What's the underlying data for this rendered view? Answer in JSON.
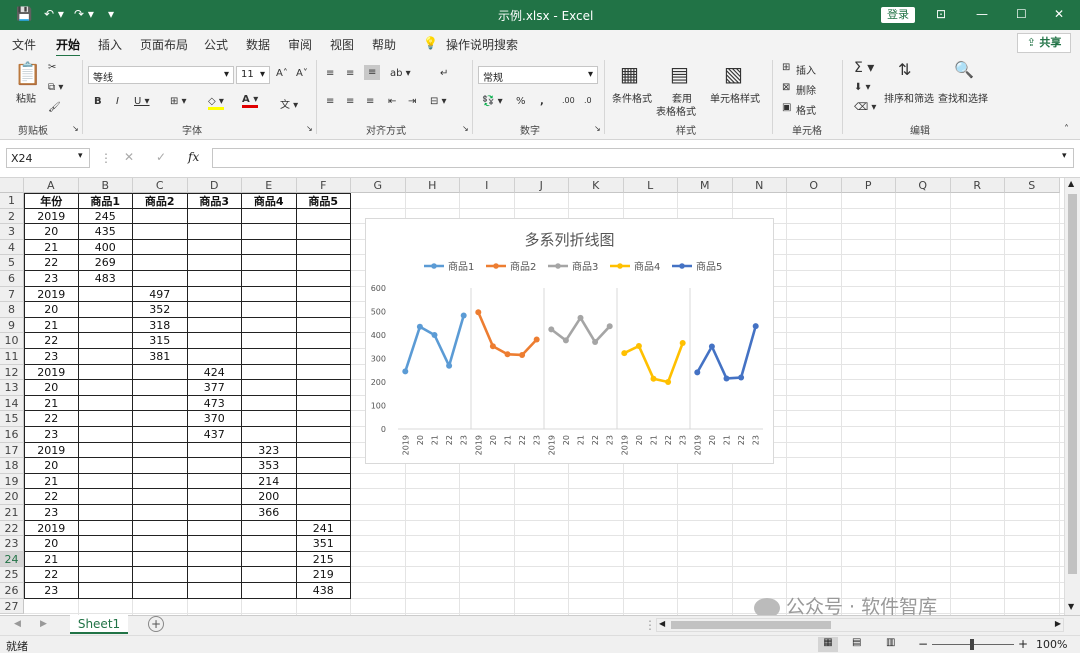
{
  "window": {
    "title": "示例.xlsx  -  Excel",
    "login": "登录"
  },
  "menu": {
    "items": [
      "文件",
      "开始",
      "插入",
      "页面布局",
      "公式",
      "数据",
      "审阅",
      "视图",
      "帮助"
    ],
    "tellme": "操作说明搜索",
    "share": "共享"
  },
  "ribbon": {
    "clipboard": {
      "label": "剪贴板",
      "paste": "粘贴"
    },
    "font": {
      "label": "字体",
      "name": "等线",
      "size": "11"
    },
    "alignment": {
      "label": "对齐方式"
    },
    "number": {
      "label": "数字",
      "format": "常规"
    },
    "styles": {
      "label": "样式",
      "cond": "条件格式",
      "table1": "套用",
      "table2": "表格格式",
      "cell": "单元格样式"
    },
    "cells": {
      "label": "单元格",
      "insert": "插入",
      "delete": "删除",
      "format": "格式"
    },
    "editing": {
      "label": "编辑",
      "sort": "排序和筛选",
      "find": "查找和选择"
    }
  },
  "formula_bar": {
    "name_box": "X24",
    "fx": "fx",
    "value": ""
  },
  "columns": [
    "A",
    "B",
    "C",
    "D",
    "E",
    "F",
    "G",
    "H",
    "I",
    "J",
    "K",
    "L",
    "M",
    "N",
    "O",
    "P",
    "Q",
    "R",
    "S"
  ],
  "rows": [
    "1",
    "2",
    "3",
    "4",
    "5",
    "6",
    "7",
    "8",
    "9",
    "10",
    "11",
    "12",
    "13",
    "14",
    "15",
    "16",
    "17",
    "18",
    "19",
    "20",
    "21",
    "22",
    "23",
    "24",
    "25",
    "26",
    "27"
  ],
  "table": {
    "headers": [
      "年份",
      "商品1",
      "商品2",
      "商品3",
      "商品4",
      "商品5"
    ],
    "years": [
      "2019",
      "20",
      "21",
      "22",
      "23",
      "2019",
      "20",
      "21",
      "22",
      "23",
      "2019",
      "20",
      "21",
      "22",
      "23",
      "2019",
      "20",
      "21",
      "22",
      "23",
      "2019",
      "20",
      "21",
      "22",
      "23"
    ],
    "series_values": [
      [
        "245",
        "435",
        "400",
        "269",
        "483"
      ],
      [
        "497",
        "352",
        "318",
        "315",
        "381"
      ],
      [
        "424",
        "377",
        "473",
        "370",
        "437"
      ],
      [
        "323",
        "353",
        "214",
        "200",
        "366"
      ],
      [
        "241",
        "351",
        "215",
        "219",
        "438"
      ]
    ]
  },
  "chart_data": {
    "type": "line",
    "title": "多系列折线图",
    "categories": [
      "2019",
      "20",
      "21",
      "22",
      "23"
    ],
    "series": [
      {
        "name": "商品1",
        "values": [
          245,
          435,
          400,
          269,
          483
        ],
        "color": "#5b9bd5"
      },
      {
        "name": "商品2",
        "values": [
          497,
          352,
          318,
          315,
          381
        ],
        "color": "#ed7d31"
      },
      {
        "name": "商品3",
        "values": [
          424,
          377,
          473,
          370,
          437
        ],
        "color": "#a5a5a5"
      },
      {
        "name": "商品4",
        "values": [
          323,
          353,
          214,
          200,
          366
        ],
        "color": "#ffc000"
      },
      {
        "name": "商品5",
        "values": [
          241,
          351,
          215,
          219,
          438
        ],
        "color": "#4472c4"
      }
    ],
    "yticks": [
      "0",
      "100",
      "200",
      "300",
      "400",
      "500",
      "600"
    ],
    "ylim": [
      0,
      600
    ],
    "grid": false,
    "legend": "top"
  },
  "sheet_tabs": {
    "active": "Sheet1"
  },
  "status": {
    "mode": "就绪",
    "zoom": "100%"
  },
  "watermark": "公众号 · 软件智库"
}
